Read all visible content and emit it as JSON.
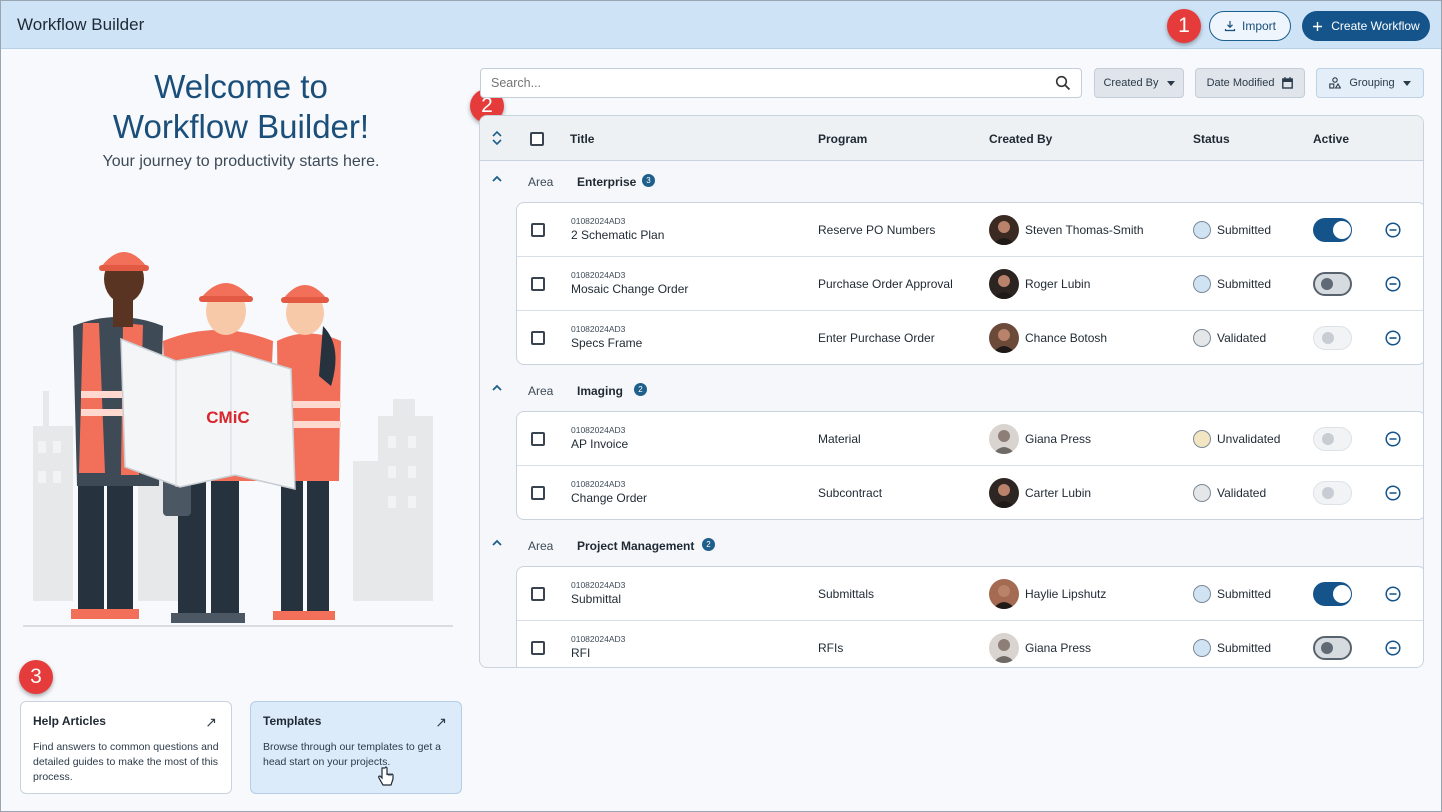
{
  "header": {
    "title": "Workflow Builder",
    "import_label": "Import",
    "create_label": "Create Workflow"
  },
  "markers": [
    "1",
    "2",
    "3"
  ],
  "welcome": {
    "line1": "Welcome to",
    "line2": "Workflow Builder!",
    "tagline": "Your journey to productivity starts here.",
    "logo_text": "CMiC"
  },
  "cards": [
    {
      "title": "Help Articles",
      "description": "Find answers to common questions and detailed guides to make the most of this process."
    },
    {
      "title": "Templates",
      "description": "Browse through our templates to get a head start on your projects."
    }
  ],
  "toolbar": {
    "search_placeholder": "Search...",
    "created_by": "Created By",
    "date_modified": "Date Modified",
    "grouping": "Grouping"
  },
  "table": {
    "columns": [
      "Title",
      "Program",
      "Created By",
      "Status",
      "Active"
    ],
    "groups": [
      {
        "area_label": "Area",
        "name": "Enterprise",
        "count": "3",
        "rows": [
          {
            "code": "01082024AD3",
            "title": "2 Schematic Plan",
            "program": "Reserve PO Numbers",
            "created_by": "Steven Thomas-Smith",
            "status": "Submitted",
            "active": true
          },
          {
            "code": "01082024AD3",
            "title": "Mosaic Change Order",
            "program": "Purchase Order Approval",
            "created_by": "Roger Lubin",
            "status": "Submitted",
            "active": false
          },
          {
            "code": "01082024AD3",
            "title": "Specs Frame",
            "program": "Enter Purchase Order",
            "created_by": "Chance Botosh",
            "status": "Validated",
            "active": false
          }
        ]
      },
      {
        "area_label": "Area",
        "name": "Imaging",
        "count": "2",
        "rows": [
          {
            "code": "01082024AD3",
            "title": "AP Invoice",
            "program": "Material",
            "created_by": "Giana Press",
            "status": "Unvalidated",
            "active": false
          },
          {
            "code": "01082024AD3",
            "title": "Change Order",
            "program": "Subcontract",
            "created_by": "Carter Lubin",
            "status": "Validated",
            "active": false
          }
        ]
      },
      {
        "area_label": "Area",
        "name": "Project Management",
        "count": "2",
        "rows": [
          {
            "code": "01082024AD3",
            "title": "Submittal",
            "program": "Submittals",
            "created_by": "Haylie Lipshutz",
            "status": "Submitted",
            "active": true
          },
          {
            "code": "01082024AD3",
            "title": "RFI",
            "program": "RFIs",
            "created_by": "Giana Press",
            "status": "Submitted",
            "active": false
          }
        ]
      }
    ]
  },
  "colors": {
    "primary": "#15548a",
    "header_bg": "#cfe3f7",
    "marker": "#e63b3b",
    "status_submitted": "#cfe3f3",
    "status_validated": "#e4e6e8",
    "status_unvalidated": "#f2e6c2",
    "vest": "#f2705a"
  }
}
